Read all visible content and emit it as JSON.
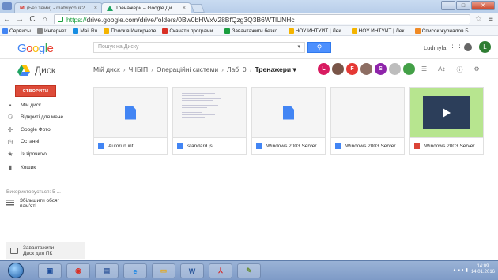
{
  "browser": {
    "tabs": [
      {
        "label": "(Без теми) - matviychuk2..."
      },
      {
        "label": "Тренажери – Google Ди..."
      }
    ],
    "url_protocol": "https://",
    "url_rest": "drive.google.com/drive/folders/0Bw0bHWxV28BfQzg3Q3B6WTlUNHc",
    "bookmarks": [
      {
        "label": "Сервисы",
        "color": "#4285f4"
      },
      {
        "label": "Интернет",
        "color": "#888888"
      },
      {
        "label": "Mail.Ru",
        "color": "#168de2"
      },
      {
        "label": "Поиск в Интернете",
        "color": "#f4b400"
      },
      {
        "label": "Скачати програми ...",
        "color": "#d93025"
      },
      {
        "label": "Завантажити безко...",
        "color": "#1a9e3f"
      },
      {
        "label": "НОУ ИНТУИТ | Лек...",
        "color": "#f4b400"
      },
      {
        "label": "НОУ ИНТУИТ | Лек...",
        "color": "#f4b400"
      },
      {
        "label": "Список журналов Б...",
        "color": "#f08a24"
      }
    ]
  },
  "header": {
    "logo": [
      "G",
      "o",
      "o",
      "g",
      "l",
      "e"
    ],
    "search_placeholder": "Пошук на Диску",
    "user_name": "Ludmyla",
    "user_initial": "L"
  },
  "drivebar": {
    "title": "Диск",
    "breadcrumbs": [
      "Мій диск",
      "ЧІІБІП",
      "Операційні системи",
      "Лаб_0"
    ],
    "current": "Тренажери",
    "shared": [
      {
        "initial": "L",
        "color": "#d81b60"
      },
      {
        "initial": "",
        "color": "#795548"
      },
      {
        "initial": "F",
        "color": "#e53935"
      },
      {
        "initial": "",
        "color": "#8d6e63"
      },
      {
        "initial": "S",
        "color": "#8e24aa"
      },
      {
        "initial": "",
        "color": "#bdbdbd"
      },
      {
        "initial": "",
        "color": "#43a047"
      }
    ]
  },
  "sidebar": {
    "new_button": "СТВОРИТИ",
    "items": [
      {
        "label": "Мій диск",
        "icon": "folder-icon"
      },
      {
        "label": "Відкриті для мене",
        "icon": "people-icon"
      },
      {
        "label": "Google Фото",
        "icon": "pinwheel-icon"
      },
      {
        "label": "Останні",
        "icon": "clock-icon"
      },
      {
        "label": "Із зірочкою",
        "icon": "star-icon"
      },
      {
        "label": "Кошик",
        "icon": "trash-icon"
      }
    ],
    "used": "Використовується: 5 ...",
    "upgrade_line1": "Збільшити обсяг",
    "upgrade_line2": "пам'яті",
    "download_line1": "Завантажити",
    "download_line2": "Диск для ПК"
  },
  "files": [
    {
      "name": "Autorun.inf",
      "type": "doc"
    },
    {
      "name": "standard.js",
      "type": "code"
    },
    {
      "name": "Windows 2003 Server...",
      "type": "doc"
    },
    {
      "name": "Windows 2003 Server...",
      "type": "blank"
    },
    {
      "name": "Windows 2003 Server...",
      "type": "video"
    }
  ],
  "taskbar": {
    "clock_time": "14:09",
    "clock_date": "14.01.2016"
  }
}
